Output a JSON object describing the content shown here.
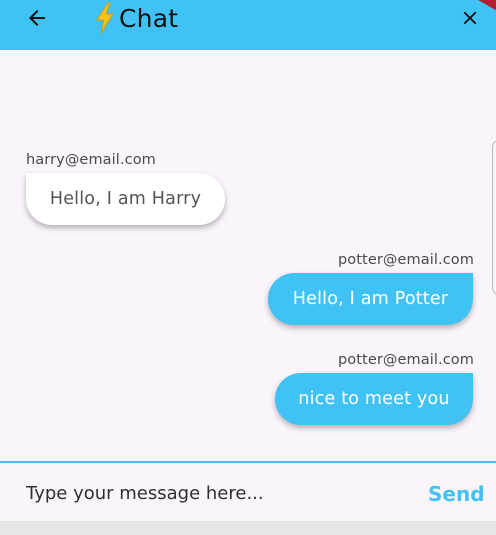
{
  "app_bar": {
    "title": "Chat",
    "back_icon": "arrow-left-icon",
    "title_icon": "lightning-bolt-icon",
    "close_icon": "close-icon",
    "background_color": "#41c2f5"
  },
  "messages": [
    {
      "sender": "harry@email.com",
      "text": "Hello, I am Harry",
      "is_me": false
    },
    {
      "sender": "potter@email.com",
      "text": "Hello, I am Potter",
      "is_me": true
    },
    {
      "sender": "potter@email.com",
      "text": "nice to meet you",
      "is_me": true
    }
  ],
  "composer": {
    "placeholder": "Type your message here...",
    "send_label": "Send",
    "accent_color": "#41c2f5"
  }
}
